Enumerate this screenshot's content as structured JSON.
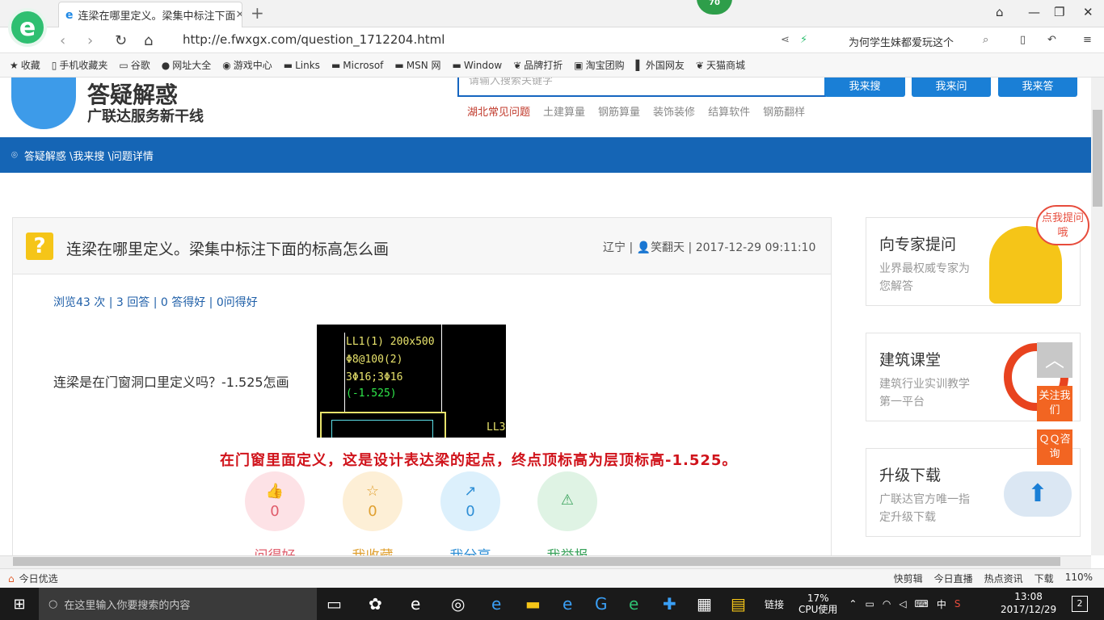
{
  "browser": {
    "tab_title": "连梁在哪里定义。梁集中标注下面",
    "tab_close": "✕",
    "new_tab": "+",
    "badge": "70",
    "url": "http://e.fwxgx.com/question_1712204.html",
    "suggest": "为何学生妹都爱玩这个",
    "bookmarks": [
      "收藏",
      "手机收藏夹",
      "谷歌",
      "网址大全",
      "游戏中心",
      "Links",
      "Microsof",
      "MSN 网",
      "Window",
      "品牌打折",
      "淘宝团购",
      "外国网友",
      "天猫商城"
    ]
  },
  "site": {
    "title": "答疑解惑",
    "subtitle": "广联达服务新干线",
    "search_placeholder": "请输入搜索关键字",
    "btn_search": "我来搜",
    "btn_ask": "我来问",
    "btn_answer": "我来答",
    "categories": [
      "湖北常见问题",
      "土建算量",
      "钢筋算量",
      "装饰装修",
      "结算软件",
      "钢筋翻样"
    ],
    "breadcrumb": "答疑解惑 \\我来搜 \\问题详情"
  },
  "question": {
    "title": "连梁在哪里定义。梁集中标注下面的标高怎么画",
    "location": "辽宁",
    "author": "笑翻天",
    "datetime": "2017-12-29 09:11:10",
    "stats": "浏览43 次 | 3 回答 | 0 答得好 | 0问得好",
    "text": "连梁是在门窗洞口里定义吗？-1.525怎画",
    "cad_lines": [
      "LL1(1) 200x500",
      "Φ8@100(2)",
      "3Φ16;3Φ16",
      "(-1.525)",
      "LL3"
    ],
    "answer": "在门窗里面定义，这是设计表达梁的起点，终点顶标高为层顶标高-1.525。",
    "actions": [
      {
        "label": "问得好",
        "count": "0",
        "color": "#e05c6b",
        "bg": "#fde2e6",
        "icon": "👍"
      },
      {
        "label": "我收藏",
        "count": "0",
        "color": "#e0a030",
        "bg": "#fdefd6",
        "icon": "☆"
      },
      {
        "label": "我分享",
        "count": "0",
        "color": "#2f8fd6",
        "bg": "#dcf0fc",
        "icon": "↗"
      },
      {
        "label": "我举报",
        "count": "",
        "color": "#3aa35c",
        "bg": "#dff3e4",
        "icon": "⚠"
      }
    ]
  },
  "sidebar": {
    "expert_title": "向专家提问",
    "expert_desc": "业界最权威专家为您解答",
    "expert_bubble": "点我提问哦",
    "course_title": "建筑课堂",
    "course_desc": "建筑行业实训教学第一平台",
    "upgrade_title": "升级下载",
    "upgrade_desc": "广联达官方唯一指定升级下载",
    "follow": "关注我们",
    "qq": "ＱＱ咨询"
  },
  "statusbar": {
    "left": "今日优选",
    "items": [
      "快剪辑",
      "今日直播",
      "热点资讯",
      "下载",
      "110%"
    ]
  },
  "taskbar": {
    "search": "在这里输入你要搜索的内容",
    "link": "链接",
    "cpu": "17%",
    "cpu_label": "CPU使用",
    "ime": "中",
    "time": "13:08",
    "date": "2017/12/29",
    "notif": "2"
  }
}
